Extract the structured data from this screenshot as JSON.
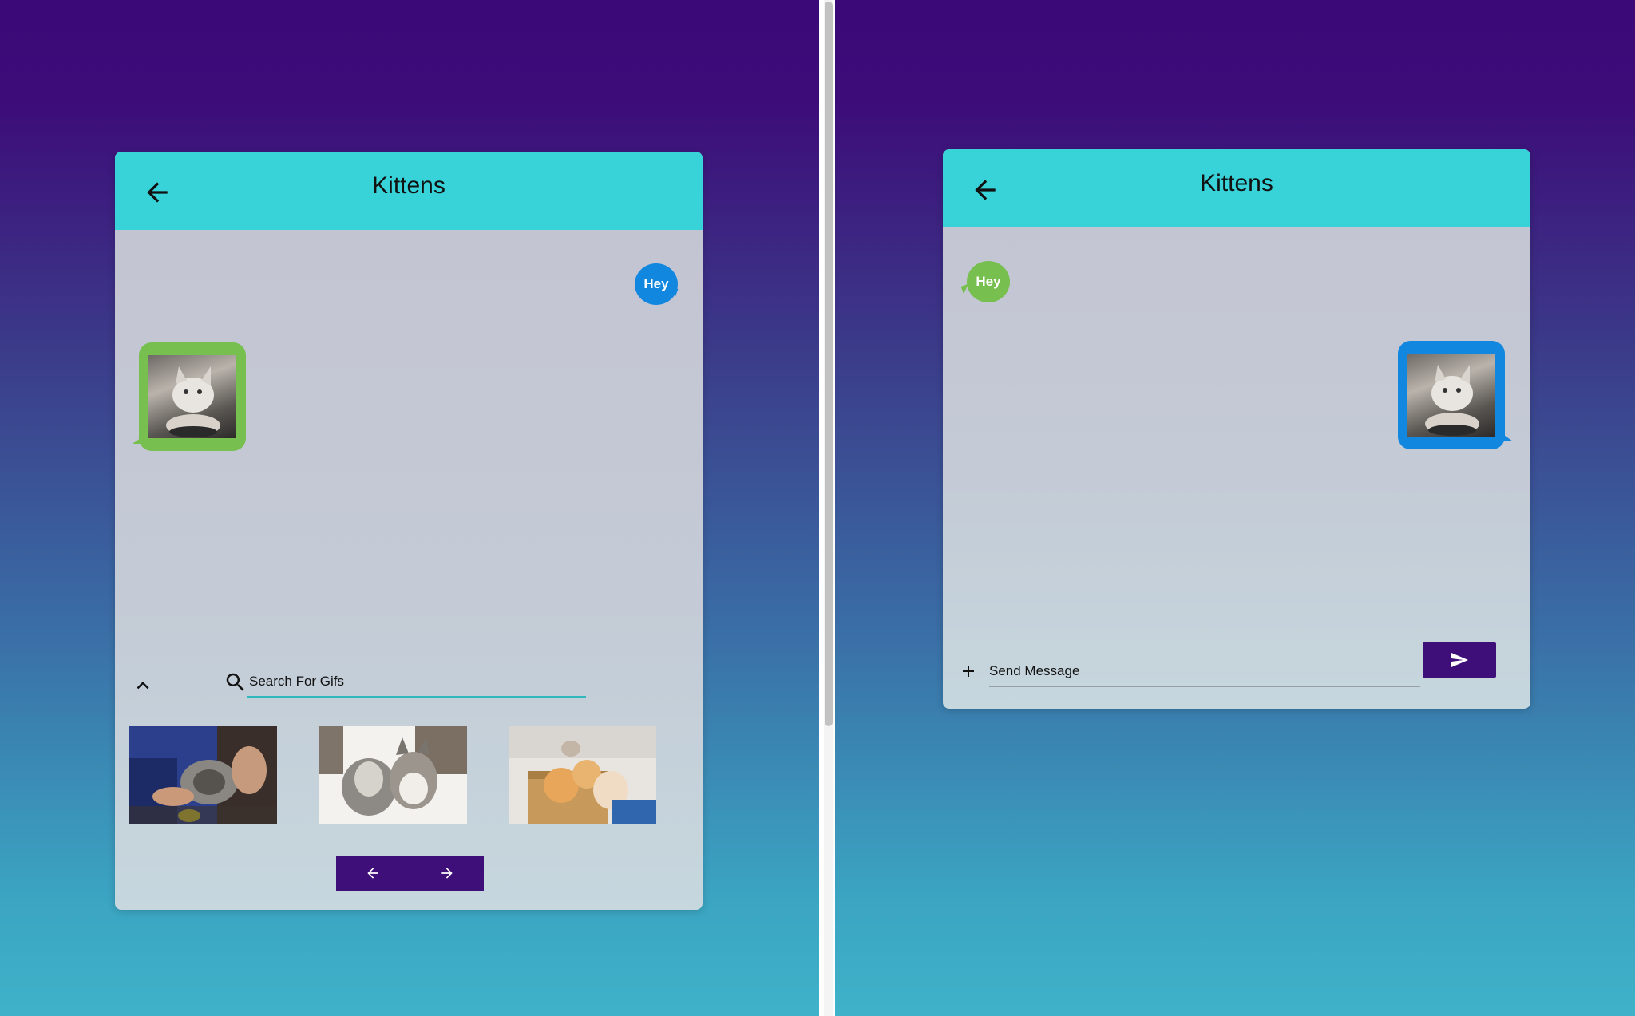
{
  "colors": {
    "header_bg": "#37d3d9",
    "accent_purple": "#3e0f78",
    "bubble_blue": "#1287e0",
    "bubble_green": "#77bf4f",
    "input_underline": "#2fb9bd"
  },
  "left_chat": {
    "title": "Kittens",
    "back_icon": "arrow-left-icon",
    "messages": [
      {
        "side": "right",
        "type": "text",
        "text": "Hey",
        "color": "#1287e0"
      },
      {
        "side": "left",
        "type": "gif",
        "content": "kitten-gif",
        "color": "#77bf4f"
      }
    ],
    "gif_panel": {
      "collapse_icon": "chevron-up-icon",
      "search_icon": "search-icon",
      "search_placeholder": "Search For Gifs",
      "results": [
        "kitten-gif-1",
        "kitten-gif-2",
        "kitten-gif-3"
      ],
      "prev_icon": "arrow-left-icon",
      "next_icon": "arrow-right-icon"
    }
  },
  "right_chat": {
    "title": "Kittens",
    "back_icon": "arrow-left-icon",
    "messages": [
      {
        "side": "left",
        "type": "text",
        "text": "Hey",
        "color": "#77bf4f"
      },
      {
        "side": "right",
        "type": "gif",
        "content": "kitten-gif",
        "color": "#1287e0"
      }
    ],
    "compose": {
      "add_icon": "plus-icon",
      "placeholder": "Send Message",
      "send_icon": "send-icon"
    }
  }
}
